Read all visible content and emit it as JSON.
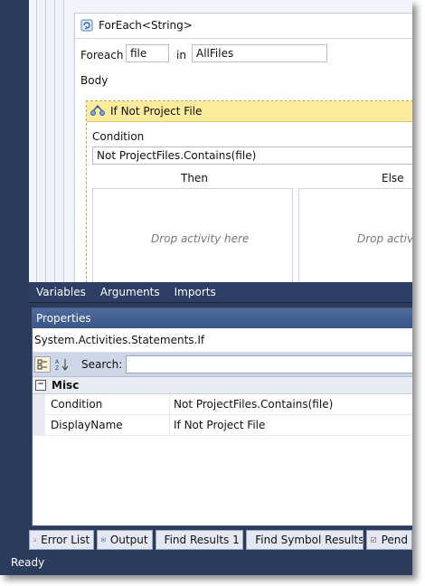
{
  "foreach": {
    "title": "ForEach<String>",
    "foreach_label": "Foreach",
    "item_value": "file",
    "in_label": "in",
    "collection_value": "AllFiles",
    "body_label": "Body"
  },
  "if_activity": {
    "title": "If Not Project File",
    "condition_label": "Condition",
    "condition_value": "Not ProjectFiles.Contains(file)",
    "then_label": "Then",
    "else_label": "Else",
    "drop_text": "Drop activity here"
  },
  "designer_tabs": [
    "Variables",
    "Arguments",
    "Imports"
  ],
  "properties": {
    "title": "Properties",
    "type_name": "System.Activities.Statements.If",
    "search_label": "Search:",
    "category": "Misc",
    "rows": [
      {
        "name": "Condition",
        "value": "Not ProjectFiles.Contains(file)"
      },
      {
        "name": "DisplayName",
        "value": "If Not Project File"
      }
    ]
  },
  "bottom_tabs": [
    "Error List",
    "Output",
    "Find Results 1",
    "Find Symbol Results",
    "Pend"
  ],
  "status": "Ready",
  "icons": [
    "foreach-icon",
    "if-icon",
    "categorized-icon",
    "alphabetical-icon",
    "error-list-icon",
    "output-icon",
    "find-results-icon",
    "find-symbol-icon",
    "pending-icon"
  ]
}
